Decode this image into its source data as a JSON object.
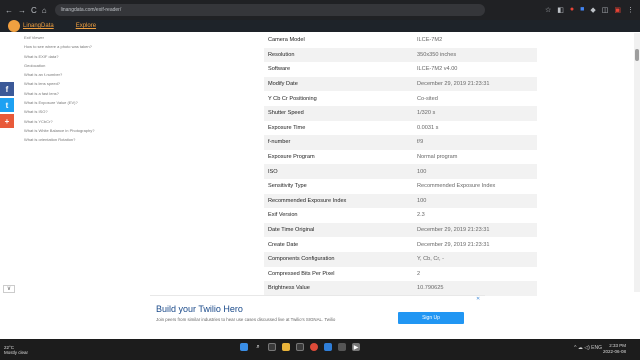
{
  "browser": {
    "url": "linangdata.com/exif-reader/",
    "nav_back": "←",
    "nav_forward": "→",
    "nav_reload": "C",
    "nav_home": "⌂",
    "ext_icons": [
      "☆",
      "◧",
      "●",
      "■",
      "◆",
      "◫",
      "▣",
      "⋮"
    ]
  },
  "site": {
    "logo_text": "LinangData",
    "nav_explore": "Explore"
  },
  "sidebar_links": [
    "Exif Viewer",
    "How to see where a photo was taken?",
    "What is EXIF data?",
    "Geolocation",
    "What is an f-number?",
    "What is lens speed?",
    "What is a fast lens?",
    "What is Exposure Value (EV)?",
    "What is ISO?",
    "What is YCbCr?",
    "What is White Balance in Photography?",
    "What is orientation Rotation?"
  ],
  "social": {
    "facebook": "f",
    "twitter": "t",
    "plus": "+"
  },
  "exif_rows": [
    {
      "key": "Camera Model",
      "value": "ILCE-7M2"
    },
    {
      "key": "Resolution",
      "value": "350x350 inches"
    },
    {
      "key": "Software",
      "value": "ILCE-7M2 v4.00"
    },
    {
      "key": "Modify Date",
      "value": "December 29, 2019 21:23:31"
    },
    {
      "key": "Y Cb Cr Positioning",
      "value": "Co-sited"
    },
    {
      "key": "Shutter Speed",
      "value": "1/320 s"
    },
    {
      "key": "Exposure Time",
      "value": "0.0031 s"
    },
    {
      "key": "f-number",
      "value": "f/9"
    },
    {
      "key": "Exposure Program",
      "value": "Normal program"
    },
    {
      "key": "ISO",
      "value": "100"
    },
    {
      "key": "Sensitivity Type",
      "value": "Recommended Exposure Index"
    },
    {
      "key": "Recommended Exposure Index",
      "value": "100"
    },
    {
      "key": "Exif Version",
      "value": "2.3"
    },
    {
      "key": "Date Time Original",
      "value": "December 29, 2019 21:23:31"
    },
    {
      "key": "Create Date",
      "value": "December 29, 2019 21:23:31"
    },
    {
      "key": "Components Configuration",
      "value": "Y, Cb, Cr, -"
    },
    {
      "key": "Compressed Bits Per Pixel",
      "value": "2"
    },
    {
      "key": "Brightness Value",
      "value": "10.790625"
    }
  ],
  "ad": {
    "title": "Build your Twilio Hero",
    "body": "Join peers from similar industries to hear use cases discussed live at Twilio's SIGNAL. Twilio",
    "button": "Sign Up",
    "close": "✕"
  },
  "collapse_label": "∨",
  "taskbar": {
    "weather_temp": "22°C",
    "weather_desc": "Mostly clear",
    "time": "2:33 PM",
    "date": "2022-06-08",
    "tray": "^  ☁  ◁)  ENG"
  },
  "colors": {
    "accent": "#f0a040",
    "ad_button": "#2196f3"
  }
}
